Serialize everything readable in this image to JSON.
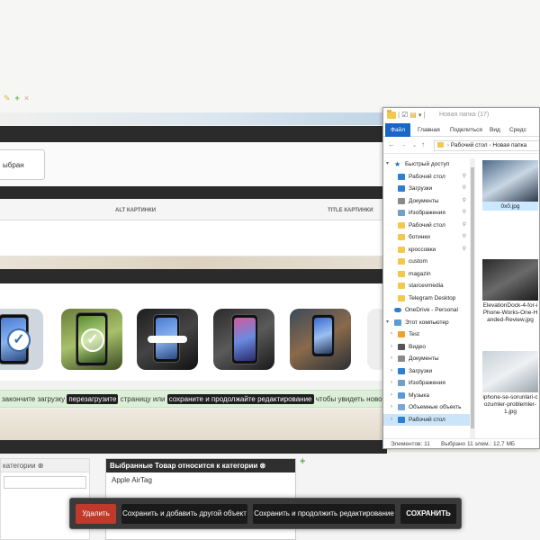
{
  "admin": {
    "chosen_label": "ыбран",
    "table_headers": {
      "alt": "ALT КАРТИНКИ",
      "title": "TITLE КАРТИНКИ"
    },
    "notice": {
      "prefix": "закончите загрузку",
      "btn_reload": "перезагрузите",
      "middle": "страницу или",
      "btn_save_continue": "сохраните и продолжайте редактирование",
      "suffix": "чтобы увидеть новое dopphot"
    },
    "category_left": {
      "header": "категории ⊗"
    },
    "category_right": {
      "header": "Выбранные Товар относится к категории ⊗",
      "items": [
        "Apple AirTag"
      ]
    }
  },
  "action_bar": {
    "delete": "Удалить",
    "save_add": "Сохранить и добавить другой объект",
    "save_continue": "Сохранить и продолжить редактирование",
    "save": "СОХРАНИТЬ"
  },
  "explorer": {
    "title": "Новая папка (17)",
    "ribbon": {
      "file": "Файл",
      "home": "Главная",
      "share": "Поделиться",
      "view": "Вид",
      "tools": "Средс"
    },
    "breadcrumb": [
      "Рабочий стол",
      "Новая папка"
    ],
    "nav": [
      {
        "label": "Быстрый доступ",
        "icon": "star-icon",
        "color": "#1a66c6"
      },
      {
        "label": "Рабочий стол",
        "icon": "desktop-icon",
        "color": "#2d7fd3",
        "pin": true
      },
      {
        "label": "Загрузки",
        "icon": "download-icon",
        "color": "#2d7fd3",
        "pin": true
      },
      {
        "label": "Документы",
        "icon": "documents-icon",
        "color": "#8a8a8a",
        "pin": true
      },
      {
        "label": "Изображения",
        "icon": "pictures-icon",
        "color": "#6fa0c8",
        "pin": true
      },
      {
        "label": "Рабочий стол",
        "icon": "folder-icon",
        "color": "#f2c94c",
        "pin": true
      },
      {
        "label": "ботинки",
        "icon": "folder-icon",
        "color": "#f2c94c",
        "pin": true
      },
      {
        "label": "кроссовки",
        "icon": "folder-icon",
        "color": "#f2c94c",
        "pin": true
      },
      {
        "label": "custom",
        "icon": "folder-icon",
        "color": "#f2c94c"
      },
      {
        "label": "magazin",
        "icon": "folder-icon",
        "color": "#f2c94c"
      },
      {
        "label": "starcevmedia",
        "icon": "folder-icon",
        "color": "#f2c94c"
      },
      {
        "label": "Telegram Desktop",
        "icon": "folder-icon",
        "color": "#f2c94c"
      },
      {
        "label": "OneDrive - Personal",
        "icon": "cloud-icon",
        "color": "#2d7fd3"
      },
      {
        "label": "Этот компьютер",
        "icon": "computer-icon",
        "color": "#5a9bd5"
      },
      {
        "label": "Test",
        "icon": "disc-icon",
        "color": "#f0a030"
      },
      {
        "label": "Видео",
        "icon": "video-icon",
        "color": "#555"
      },
      {
        "label": "Документы",
        "icon": "documents-icon",
        "color": "#8a8a8a"
      },
      {
        "label": "Загрузки",
        "icon": "download-icon",
        "color": "#2d7fd3"
      },
      {
        "label": "Изображения",
        "icon": "pictures-icon",
        "color": "#6fa0c8"
      },
      {
        "label": "Музыка",
        "icon": "music-icon",
        "color": "#5a9bd5"
      },
      {
        "label": "Объемные объекть",
        "icon": "cube-icon",
        "color": "#7aa6d6"
      },
      {
        "label": "Рабочий стол",
        "icon": "desktop-icon",
        "color": "#2d7fd3",
        "selected": true
      }
    ],
    "files": [
      {
        "name": "0x0.jpg",
        "selected": true
      },
      {
        "name": "ElevationDock-4-for-iPhone-Works-One-Handed-Review.jpg",
        "selected": false
      },
      {
        "name": "iphone-se-sorunlari-cozumler-problemler-1.jpg",
        "selected": false
      }
    ],
    "status": {
      "count": "Элементов: 11",
      "selection": "Выбрано 11 элем.: 12,7 МБ"
    }
  }
}
